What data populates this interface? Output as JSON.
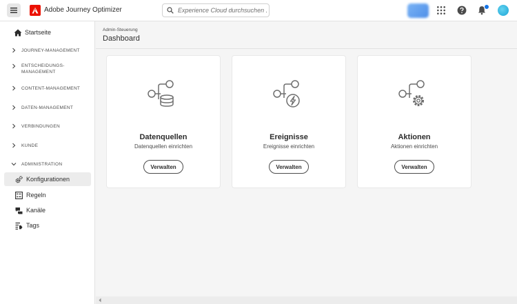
{
  "app": {
    "title": "Adobe Journey Optimizer",
    "search_placeholder": "Experience Cloud durchsuchen ...",
    "logo_icon": "adobe-logo-icon",
    "accent_color": "#eb1000"
  },
  "sidebar": {
    "home": "Startseite",
    "sections": [
      {
        "label": "JOURNEY-MANAGEMENT",
        "expanded": false
      },
      {
        "label": "ENTSCHEIDUNGS-MANAGEMENT",
        "expanded": false
      },
      {
        "label": "CONTENT-MANAGEMENT",
        "expanded": false
      },
      {
        "label": "DATEN-MANAGEMENT",
        "expanded": false
      },
      {
        "label": "VERBINDUNGEN",
        "expanded": false
      },
      {
        "label": "KUNDE",
        "expanded": false
      },
      {
        "label": "ADMINISTRATION",
        "expanded": true
      }
    ],
    "admin_items": [
      {
        "label": "Konfigurationen",
        "icon": "gears-icon",
        "active": true
      },
      {
        "label": "Regeln",
        "icon": "rules-icon",
        "active": false
      },
      {
        "label": "Kanäle",
        "icon": "channels-icon",
        "active": false
      },
      {
        "label": "Tags",
        "icon": "tags-icon",
        "active": false
      }
    ]
  },
  "main": {
    "breadcrumb": "Admin-Steuerung",
    "title": "Dashboard",
    "cards": [
      {
        "title": "Datenquellen",
        "subtitle": "Datenquellen einrichten",
        "button": "Verwalten",
        "icon": "data-source-icon"
      },
      {
        "title": "Ereignisse",
        "subtitle": "Ereignisse einrichten",
        "button": "Verwalten",
        "icon": "event-icon"
      },
      {
        "title": "Aktionen",
        "subtitle": "Aktionen einrichten",
        "button": "Verwalten",
        "icon": "action-gear-icon"
      }
    ]
  }
}
